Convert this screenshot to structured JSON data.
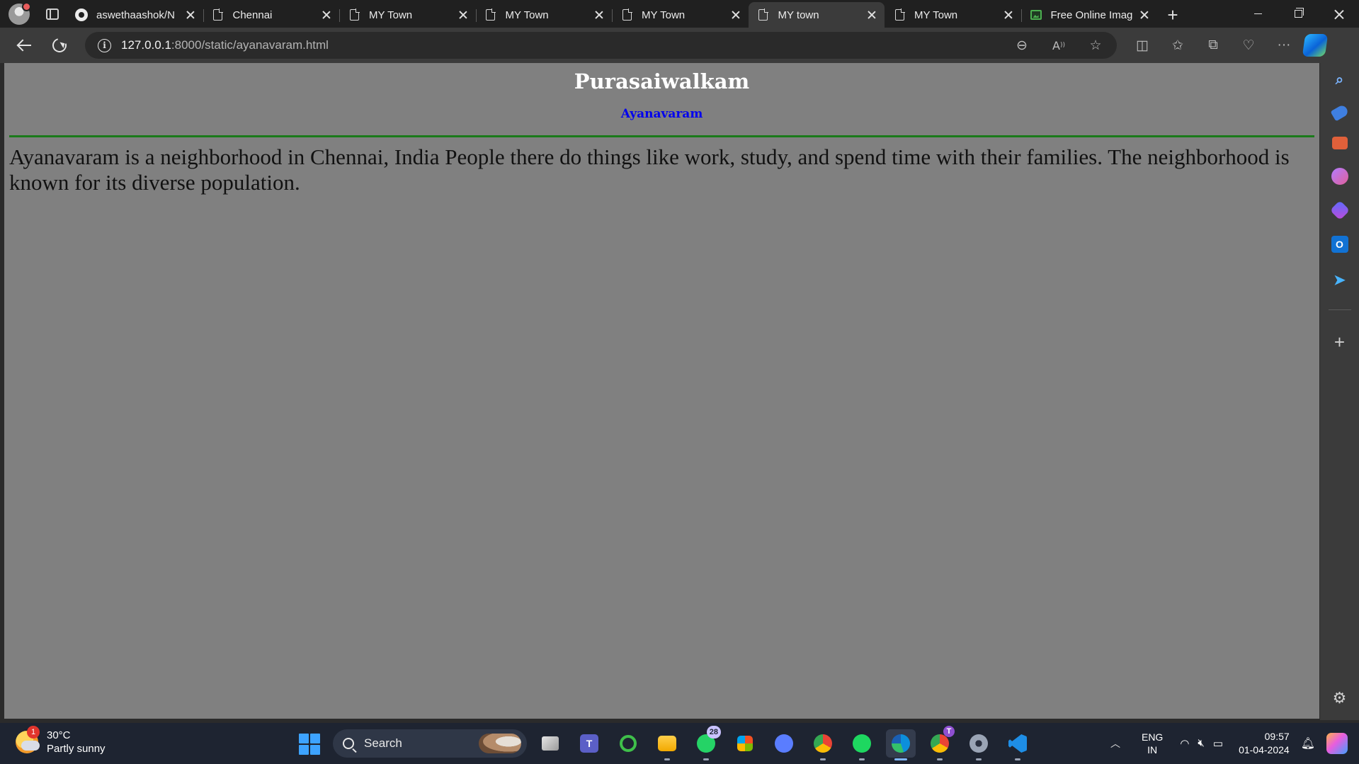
{
  "tabs": [
    {
      "title": "aswethaashok/N",
      "icon": "github-icon",
      "active": false
    },
    {
      "title": "Chennai",
      "icon": "page-icon",
      "active": false
    },
    {
      "title": "MY Town",
      "icon": "page-icon",
      "active": false
    },
    {
      "title": "MY Town",
      "icon": "page-icon",
      "active": false
    },
    {
      "title": "MY Town",
      "icon": "page-icon",
      "active": false
    },
    {
      "title": "MY town",
      "icon": "page-icon",
      "active": true
    },
    {
      "title": "MY Town",
      "icon": "page-icon",
      "active": false
    },
    {
      "title": "Free Online Imag",
      "icon": "image-icon",
      "active": false
    }
  ],
  "address": {
    "host": "127.0.0.1",
    "path": ":8000/static/ayanavaram.html"
  },
  "page": {
    "heading": "Purasaiwalkam",
    "subheading_link": "Ayanavaram",
    "paragraph": "Ayanavaram is a neighborhood in Chennai, India People there do things like work, study, and spend time with their families. The neighborhood is known for its diverse population.",
    "background": "#808080",
    "rule_color": "#1a7a1a",
    "link_color": "#0000ee"
  },
  "taskbar": {
    "weather": {
      "temp": "30°C",
      "condition": "Partly sunny",
      "badge": "1"
    },
    "search_label": "Search",
    "whatsapp_badge": "28",
    "chrome_badge": "T",
    "lang_top": "ENG",
    "lang_bottom": "IN",
    "time": "09:57",
    "date": "01-04-2024"
  }
}
